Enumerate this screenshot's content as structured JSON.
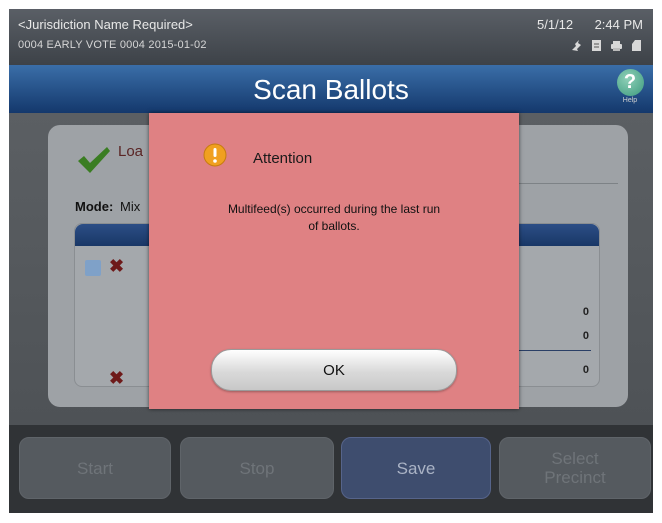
{
  "status_bar": {
    "jurisdiction": "<Jurisdiction Name Required>",
    "election": "0004 EARLY VOTE 0004   2015-01-02",
    "date": "5/1/12",
    "time": "2:44 PM",
    "icons": [
      "network-icon",
      "document-icon",
      "printer-icon",
      "memory-card-icon"
    ]
  },
  "title_bar": {
    "title": "Scan Ballots",
    "help_label": "Help",
    "help_glyph": "?"
  },
  "background_panel": {
    "status_text": "Loa",
    "mode_label": "Mode:",
    "mode_value": "Mix",
    "counts": [
      "0",
      "0",
      "0"
    ]
  },
  "buttons": {
    "start": "Start",
    "stop": "Stop",
    "save": "Save",
    "select_precinct_line1": "Select",
    "select_precinct_line2": "Precinct"
  },
  "dialog": {
    "heading": "Attention",
    "message_line1": "Multifeed(s) occurred during the last run",
    "message_line2": "of ballots.",
    "ok_label": "OK"
  },
  "colors": {
    "title_blue": "#1d4b86",
    "dialog_bg": "#df8183",
    "warning_orange": "#f0a020",
    "check_green": "#4a9b2a"
  }
}
